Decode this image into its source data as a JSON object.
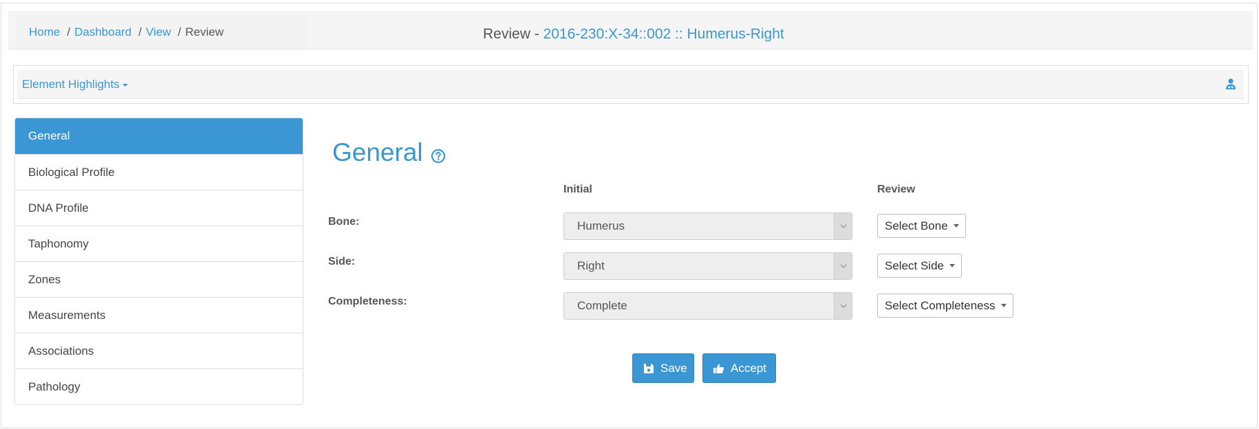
{
  "breadcrumb": {
    "items": [
      "Home",
      "Dashboard",
      "View"
    ],
    "separator": "/",
    "current": "Review"
  },
  "header": {
    "title_prefix": "Review - ",
    "title_record": "2016-230:X-34::002 :: Humerus-Right"
  },
  "highlights": {
    "label": "Element Highlights",
    "user_icon": "user-icon"
  },
  "sidebar": {
    "items": [
      {
        "label": "General",
        "active": true
      },
      {
        "label": "Biological Profile"
      },
      {
        "label": "DNA Profile"
      },
      {
        "label": "Taphonomy"
      },
      {
        "label": "Zones"
      },
      {
        "label": "Measurements"
      },
      {
        "label": "Associations"
      },
      {
        "label": "Pathology"
      }
    ]
  },
  "section": {
    "title": "General",
    "help_icon": "question-circle-icon"
  },
  "form": {
    "col_initial": "Initial",
    "col_review": "Review",
    "rows": [
      {
        "label": "Bone:",
        "initial_value": "Humerus",
        "review_value": "Select Bone"
      },
      {
        "label": "Side:",
        "initial_value": "Right",
        "review_value": "Select Side"
      },
      {
        "label": "Completeness:",
        "initial_value": "Complete",
        "review_value": "Select Completeness"
      }
    ]
  },
  "actions": {
    "save_label": "Save",
    "accept_label": "Accept"
  },
  "colors": {
    "accent": "#3a97d4",
    "panel_bg": "#f5f5f5",
    "border": "#dddddd"
  }
}
